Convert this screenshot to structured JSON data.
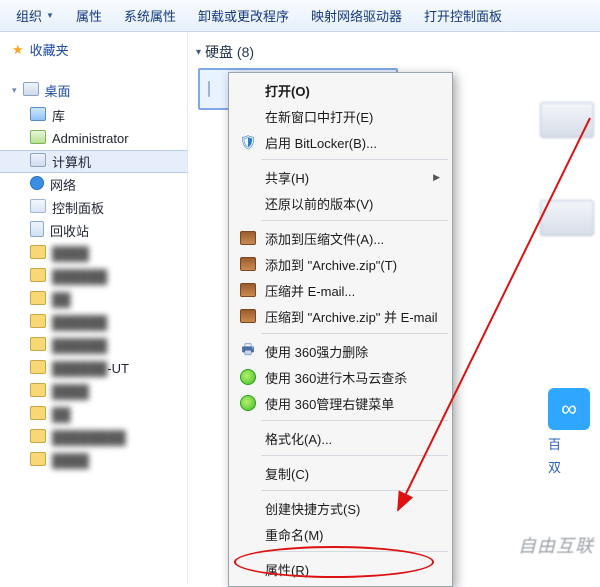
{
  "toolbar": {
    "organize": "组织",
    "properties": "属性",
    "system_properties": "系统属性",
    "uninstall_change": "卸载或更改程序",
    "map_drive": "映射网络驱动器",
    "open_control": "打开控制面板"
  },
  "sidebar": {
    "favorites": "收藏夹",
    "desktop": "桌面",
    "libraries": "库",
    "administrator": "Administrator",
    "computer": "计算机",
    "network": "网络",
    "control_panel": "控制面板",
    "recycle_bin": "回收站",
    "blurred_suffix": "-UT"
  },
  "content": {
    "drives_header": "硬盘 (8)"
  },
  "context_menu": {
    "open": "打开(O)",
    "open_new_window": "在新窗口中打开(E)",
    "enable_bitlocker": "启用 BitLocker(B)...",
    "share": "共享(H)",
    "restore_previous": "还原以前的版本(V)",
    "add_to_archive": "添加到压缩文件(A)...",
    "add_to_archive_zip": "添加到 \"Archive.zip\"(T)",
    "compress_email": "压缩并 E-mail...",
    "compress_to_zip_email": "压缩到 \"Archive.zip\" 并 E-mail",
    "delete_360": "使用 360强力删除",
    "scan_360": "使用 360进行木马云查杀",
    "manage_360": "使用 360管理右键菜单",
    "format": "格式化(A)...",
    "copy": "复制(C)",
    "create_shortcut": "创建快捷方式(S)",
    "rename": "重命名(M)",
    "properties": "属性(R)"
  },
  "right": {
    "cloud_label_1": "百",
    "cloud_label_2": "双"
  },
  "watermark": "自由互联"
}
